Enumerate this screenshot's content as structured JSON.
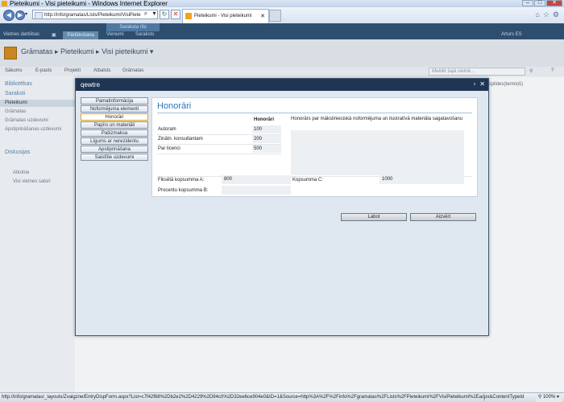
{
  "browser": {
    "window_title": "Pieteikumi - Visi pieteikumi - Windows Internet Explorer",
    "address": "http://info/gramatas/Lists/Pieteikumi/VisiPiete",
    "tab_title": "Pieteikumi - Visi pieteikumi",
    "status_url": "http://info/gramatas/_layouts/Zvaigzne/EntryDispForm.aspx?List=c7f42f68%2Db2e2%2D4229%2D94c0%2D32ee6ce904e0&ID=1&Source=http%3A%2F%2Finfo%2Fgramatas%2FLists%2FPieteikumi%2FVisiPieteikumi%2Easpx&ContentTypeId",
    "zoom": "100%"
  },
  "sharepoint": {
    "site_actions": "Vietnes darbības",
    "context_group": "Saraksta rīki",
    "ribbon_tabs": [
      "Pārlūkošana",
      "Vienumi",
      "Saraksts"
    ],
    "user": "Arturs ES",
    "breadcrumb": "Grāmatas ▸ Pieteikumi ▸ Visi pieteikumi ▾",
    "top_tabs": [
      "Sākums",
      "E-pasts",
      "Projekti",
      "Atbalsts",
      "Grāmatas"
    ],
    "search_placeholder": "Meklēt šajā vietnē...",
    "right_col": "Izpildes(termiņš)",
    "quicklaunch": {
      "libraries": "Bibliotēkas",
      "lists": "Saraksti",
      "list_items": [
        "Pieteikumi",
        "Grāmatas",
        "Grāmatas uzdevumi",
        "Apstiprināšanas uzdevumi"
      ],
      "discussions": "Diskusijas",
      "recycle": "Atkritne",
      "all_content": "Visi vietnes saturi"
    }
  },
  "dialog": {
    "title": "qewtre",
    "nav": [
      "Pamatinformācija",
      "Noformējuma elementi",
      "Honorāri",
      "Papīrs un materiāli",
      "Pašizmaksa",
      "Līgums ar nerezidentu",
      "Apstiprināšana",
      "Saistītie uzdevumi"
    ],
    "active_nav": "Honorāri",
    "section_title": "Honorāri",
    "fee_header": "Honorāri",
    "fees": [
      {
        "label": "Autoram",
        "value": "100"
      },
      {
        "label": "Zinātn. konsultantam",
        "value": "200"
      },
      {
        "label": "Par licenci",
        "value": "500"
      }
    ],
    "description_label": "Honorārs par mākslinieciskā noformējuma un ilustratīvā materiāla sagatavošanu",
    "fixed_total_label": "Fiksētā kopsumma A:",
    "fixed_total_value": "800",
    "percent_total_label": "Procentu kopsumma B:",
    "percent_total_value": "",
    "total_c_label": "Kopsumma C:",
    "total_c_value": "1000",
    "edit_button": "Labot",
    "close_button": "Aizvērt"
  }
}
